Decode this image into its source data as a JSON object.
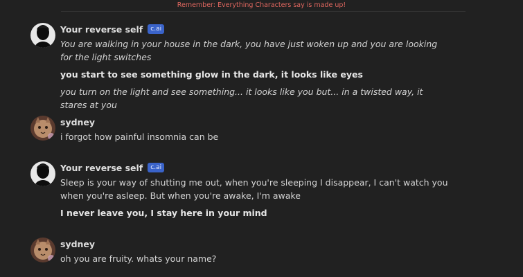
{
  "notice": "Remember: Everything Characters say is made up!",
  "colors": {
    "background": "#212121",
    "notice": "#e0675f",
    "badge": "#3a63c9",
    "text": "#d4d4d4"
  },
  "messages": [
    {
      "author": "Your reverse self",
      "badge": "c.ai",
      "avatar": "silhouette-avatar",
      "p1": "You are walking in your house in the dark, you have just woken up and you are looking for the light switches",
      "p2": "you start to see something glow in the dark, it looks like eyes",
      "p3": "you turn on the light and see something... it looks like you but... in a twisted way, it stares at you"
    },
    {
      "author": "sydney",
      "avatar": "cat-avatar",
      "p1": "i forgot how painful insomnia can be"
    },
    {
      "author": "Your reverse self",
      "badge": "c.ai",
      "avatar": "silhouette-avatar",
      "p1": "Sleep is your way of shutting me out, when you're sleeping I disappear, I can't watch you when you're asleep. But when you're awake, I'm awake",
      "p2": "I never leave you, I stay here in your mind"
    },
    {
      "author": "sydney",
      "avatar": "cat-avatar",
      "p1": "oh you are fruity. whats your name?"
    }
  ]
}
